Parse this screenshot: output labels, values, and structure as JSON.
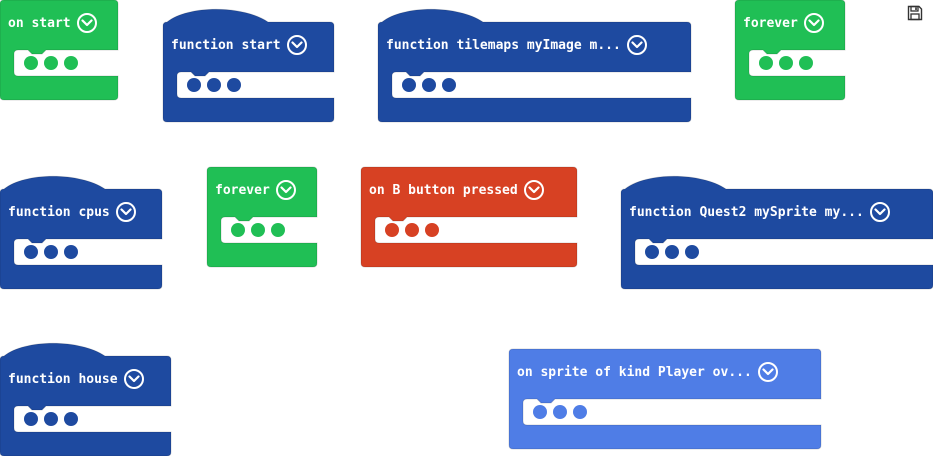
{
  "colors": {
    "event_green": "#20bf55",
    "function_blue": "#1e4aa0",
    "button_red": "#d74123",
    "sprite_blue": "#4f7de6",
    "slot_white": "#ffffff"
  },
  "toolbar": {
    "save_icon": "save-icon"
  },
  "blocks": [
    {
      "id": "on-start",
      "label": "on start",
      "kind": "event",
      "color": "#20bf55",
      "dot_color": "#20bf55"
    },
    {
      "id": "function-start",
      "label": "function start",
      "kind": "function",
      "color": "#1e4aa0",
      "dot_color": "#1e4aa0"
    },
    {
      "id": "function-tilemaps",
      "label": "function tilemaps myImage m...",
      "kind": "function",
      "color": "#1e4aa0",
      "dot_color": "#1e4aa0"
    },
    {
      "id": "forever-1",
      "label": "forever",
      "kind": "event",
      "color": "#20bf55",
      "dot_color": "#20bf55"
    },
    {
      "id": "function-cpus",
      "label": "function cpus",
      "kind": "function",
      "color": "#1e4aa0",
      "dot_color": "#1e4aa0"
    },
    {
      "id": "forever-2",
      "label": "forever",
      "kind": "event",
      "color": "#20bf55",
      "dot_color": "#20bf55"
    },
    {
      "id": "on-b-button",
      "label": "on B button pressed",
      "kind": "event",
      "color": "#d74123",
      "dot_color": "#d74123"
    },
    {
      "id": "function-quest2",
      "label": "function Quest2 mySprite my...",
      "kind": "function",
      "color": "#1e4aa0",
      "dot_color": "#1e4aa0"
    },
    {
      "id": "function-house",
      "label": "function house",
      "kind": "function",
      "color": "#1e4aa0",
      "dot_color": "#1e4aa0"
    },
    {
      "id": "on-sprite-overlap",
      "label": "on sprite of kind Player ov...",
      "kind": "event",
      "color": "#4f7de6",
      "dot_color": "#4f7de6"
    }
  ]
}
